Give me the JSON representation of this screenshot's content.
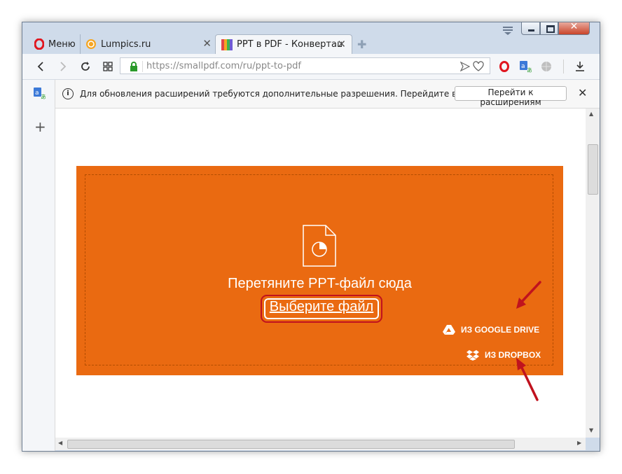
{
  "tabs": [
    {
      "label": "Меню",
      "icon": "opera-icon"
    },
    {
      "label": "Lumpics.ru",
      "icon": "lumpics-favicon"
    },
    {
      "label": "PPT в PDF - Конвертация",
      "icon": "smallpdf-favicon",
      "active": true
    }
  ],
  "toolbar": {
    "url": "https://smallpdf.com/ru/ppt-to-pdf"
  },
  "infobar": {
    "message": "Для обновления расширений требуются дополнительные разрешения. Перейдите в менедже...",
    "button_label": "Перейти к расширениям"
  },
  "upload": {
    "drop_text": "Перетяните PPT-файл сюда",
    "choose_file": "Выберите файл",
    "google_drive": "ИЗ GOOGLE DRIVE",
    "dropbox": "ИЗ DROPBOX"
  },
  "colors": {
    "upload_bg": "#ea6a11",
    "highlight": "#c0121e"
  }
}
